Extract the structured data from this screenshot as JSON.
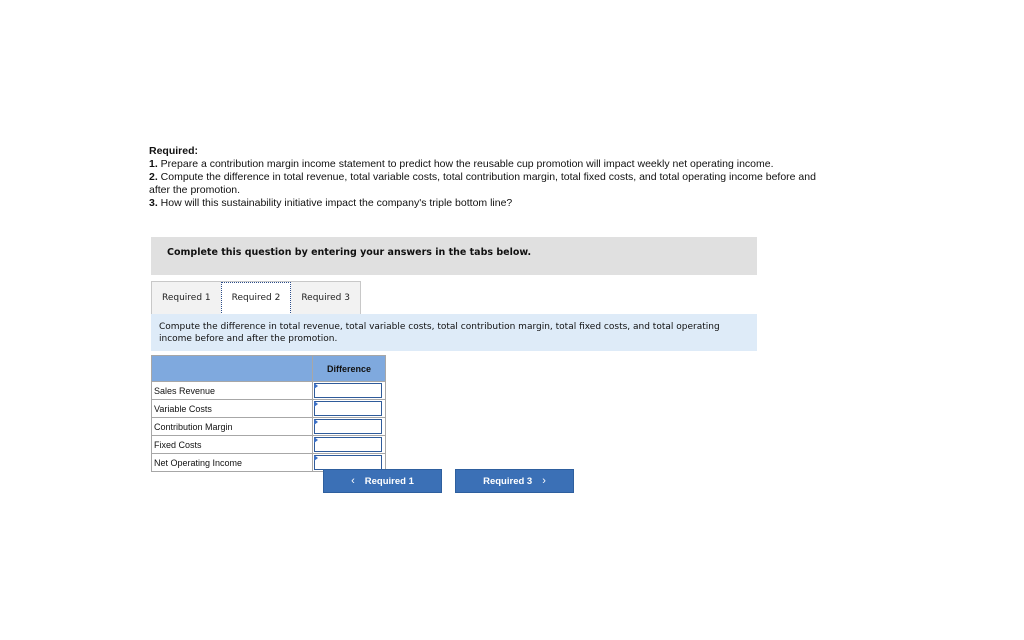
{
  "required": {
    "title": "Required:",
    "items": [
      {
        "num": "1.",
        "text": " Prepare a contribution margin income statement to predict how the reusable cup promotion will impact weekly net operating income."
      },
      {
        "num": "2.",
        "text": " Compute the difference in total revenue, total variable costs, total contribution margin, total fixed costs, and total operating income before and after the promotion."
      },
      {
        "num": "3.",
        "text": " How will this sustainability initiative impact the company's triple bottom line?"
      }
    ]
  },
  "banner": "Complete this question by entering your answers in the tabs below.",
  "tabs": [
    {
      "label": "Required 1",
      "active": false
    },
    {
      "label": "Required 2",
      "active": true
    },
    {
      "label": "Required 3",
      "active": false
    }
  ],
  "instruction": "Compute the difference in total revenue, total variable costs, total contribution margin, total fixed costs, and total operating income before and after the promotion.",
  "table": {
    "header": {
      "label": "",
      "difference": "Difference"
    },
    "rows": [
      {
        "label": "Sales Revenue",
        "value": ""
      },
      {
        "label": "Variable Costs",
        "value": ""
      },
      {
        "label": "Contribution Margin",
        "value": ""
      },
      {
        "label": "Fixed Costs",
        "value": ""
      },
      {
        "label": "Net Operating Income",
        "value": ""
      }
    ]
  },
  "nav": {
    "prev_label": "Required 1",
    "next_label": "Required 3",
    "prev_icon": "chevron-left-icon",
    "next_icon": "chevron-right-icon"
  },
  "colors": {
    "header_blue": "#7fa9de",
    "button_blue": "#3b70b6",
    "instruction_bg": "#deebf8",
    "banner_bg": "#e0e0e0"
  }
}
